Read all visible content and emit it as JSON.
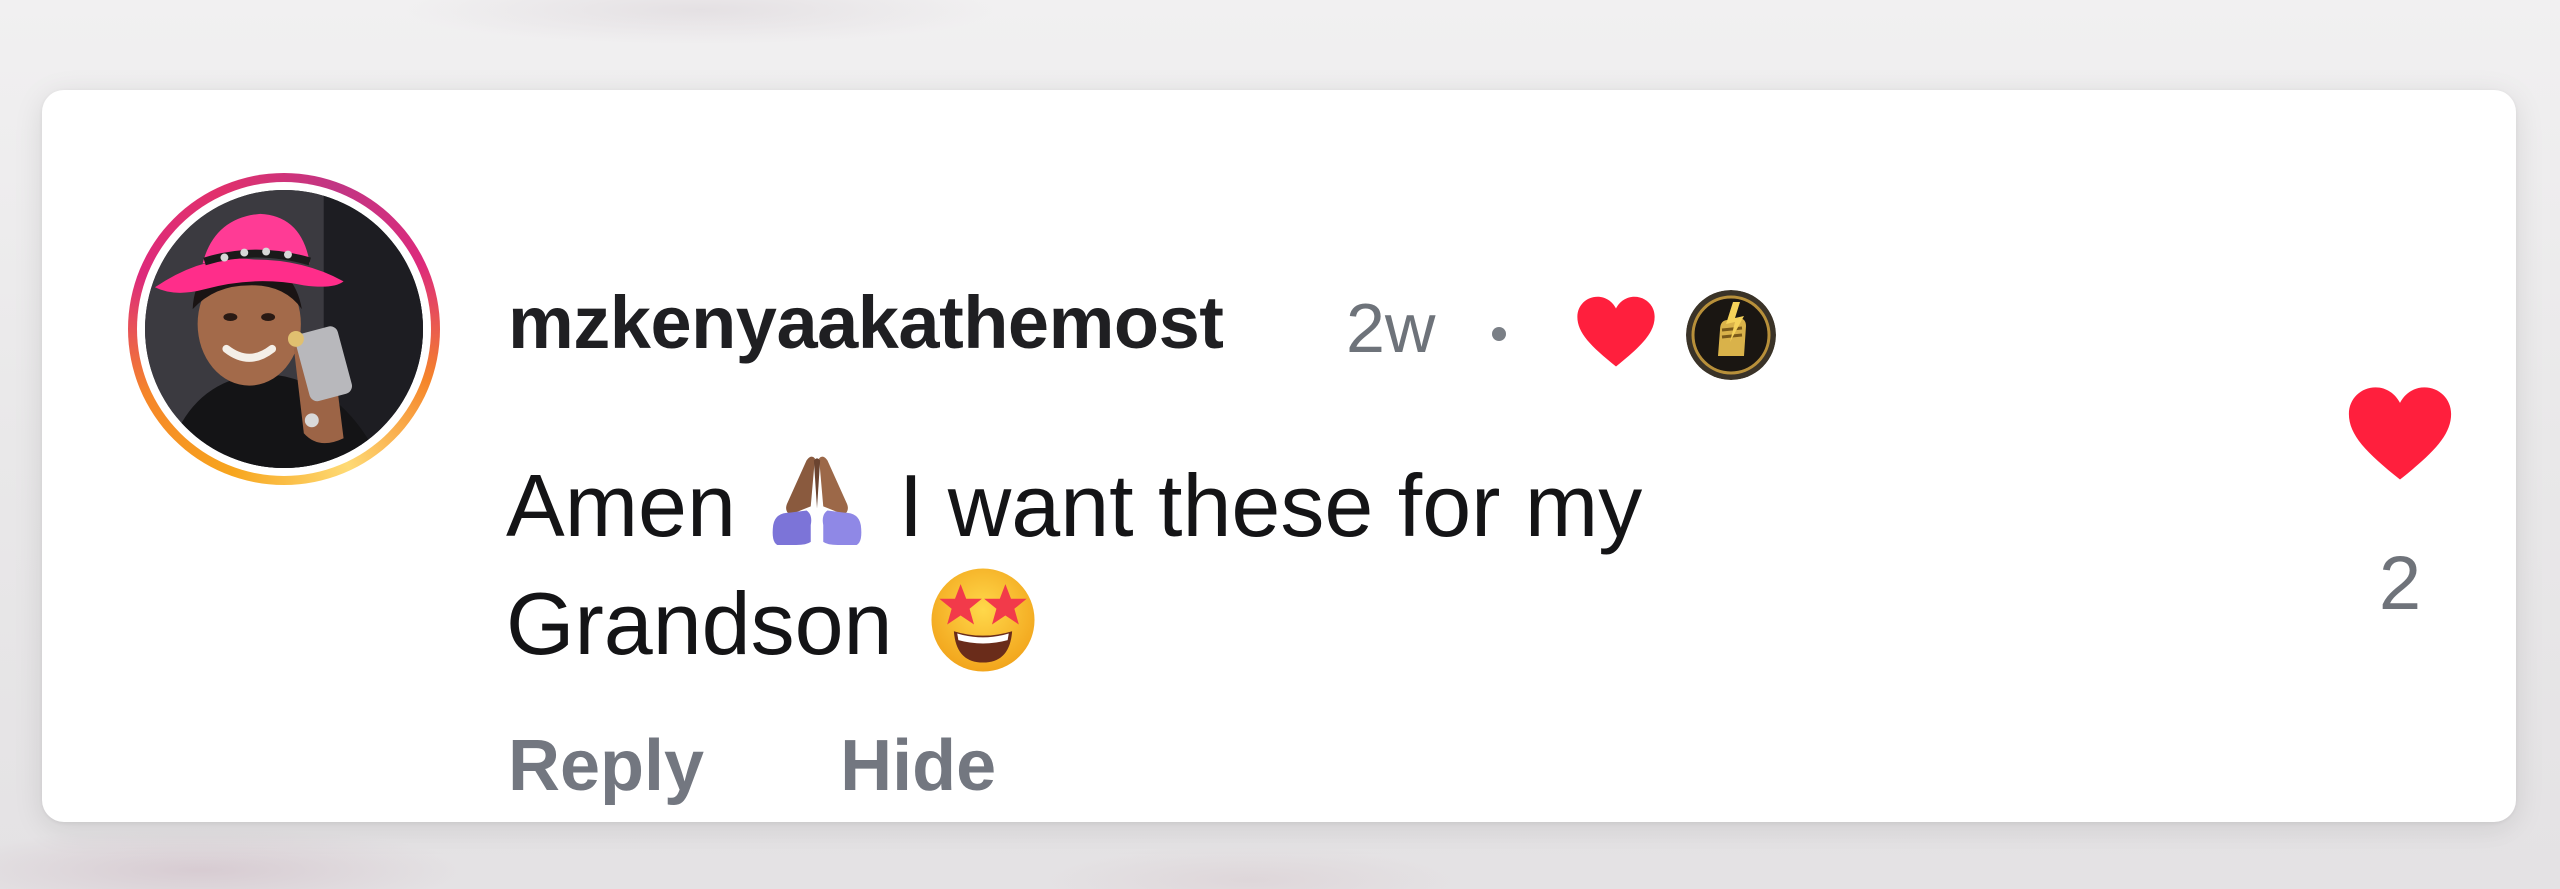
{
  "comment": {
    "username": "mzkenyaakathemost",
    "timestamp": "2w",
    "separator": "•",
    "text_line1_before_emoji": "Amen",
    "text_line1_after_emoji": "I want these for my",
    "text_line2": "Grandson",
    "emoji_1": "folded-hands-emoji",
    "emoji_2": "star-struck-emoji",
    "creator_liked_icon": "red-heart-icon",
    "creator_avatar_icon": "creator-avatar",
    "avatar_story_ring": true
  },
  "actions": {
    "reply_label": "Reply",
    "hide_label": "Hide"
  },
  "likes": {
    "icon": "heart-icon",
    "liked": true,
    "count": "2"
  },
  "colors": {
    "heart_red": "#ff1f3d",
    "username": "#1f1f22",
    "secondary_text": "#737780",
    "story_ring_start": "#f58529",
    "story_ring_end": "#dd2a7b"
  }
}
